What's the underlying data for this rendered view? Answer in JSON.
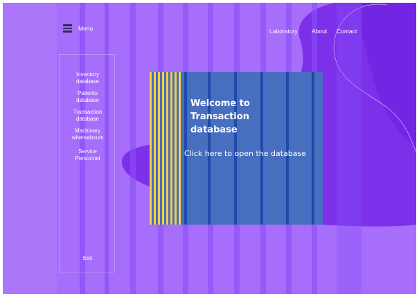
{
  "header": {
    "menu_label": "Menu",
    "nav": [
      "Laboratory",
      "About",
      "Contact"
    ]
  },
  "sidebar": {
    "items": [
      {
        "lines": [
          "Inventory",
          "database"
        ]
      },
      {
        "lines": [
          "Patients",
          "database"
        ]
      },
      {
        "lines": [
          "Transaction",
          "database"
        ]
      },
      {
        "lines": [
          "Machinary",
          "whereabouts"
        ]
      },
      {
        "lines": [
          "Service",
          "Personnel"
        ]
      }
    ],
    "exit_label": "Exit"
  },
  "card": {
    "title_lines": [
      "Welcome to",
      "Transaction",
      "database"
    ],
    "open_link": "Click here to open the database"
  },
  "colors": {
    "background": "#a76dfb",
    "blob": "#7a2de8",
    "card": "#476ebf",
    "card_stripe": "#1e4aa9",
    "accent_yellow": "#f3cf49",
    "text": "#ffffff"
  },
  "icons": {
    "menu": "hamburger-menu-icon"
  }
}
